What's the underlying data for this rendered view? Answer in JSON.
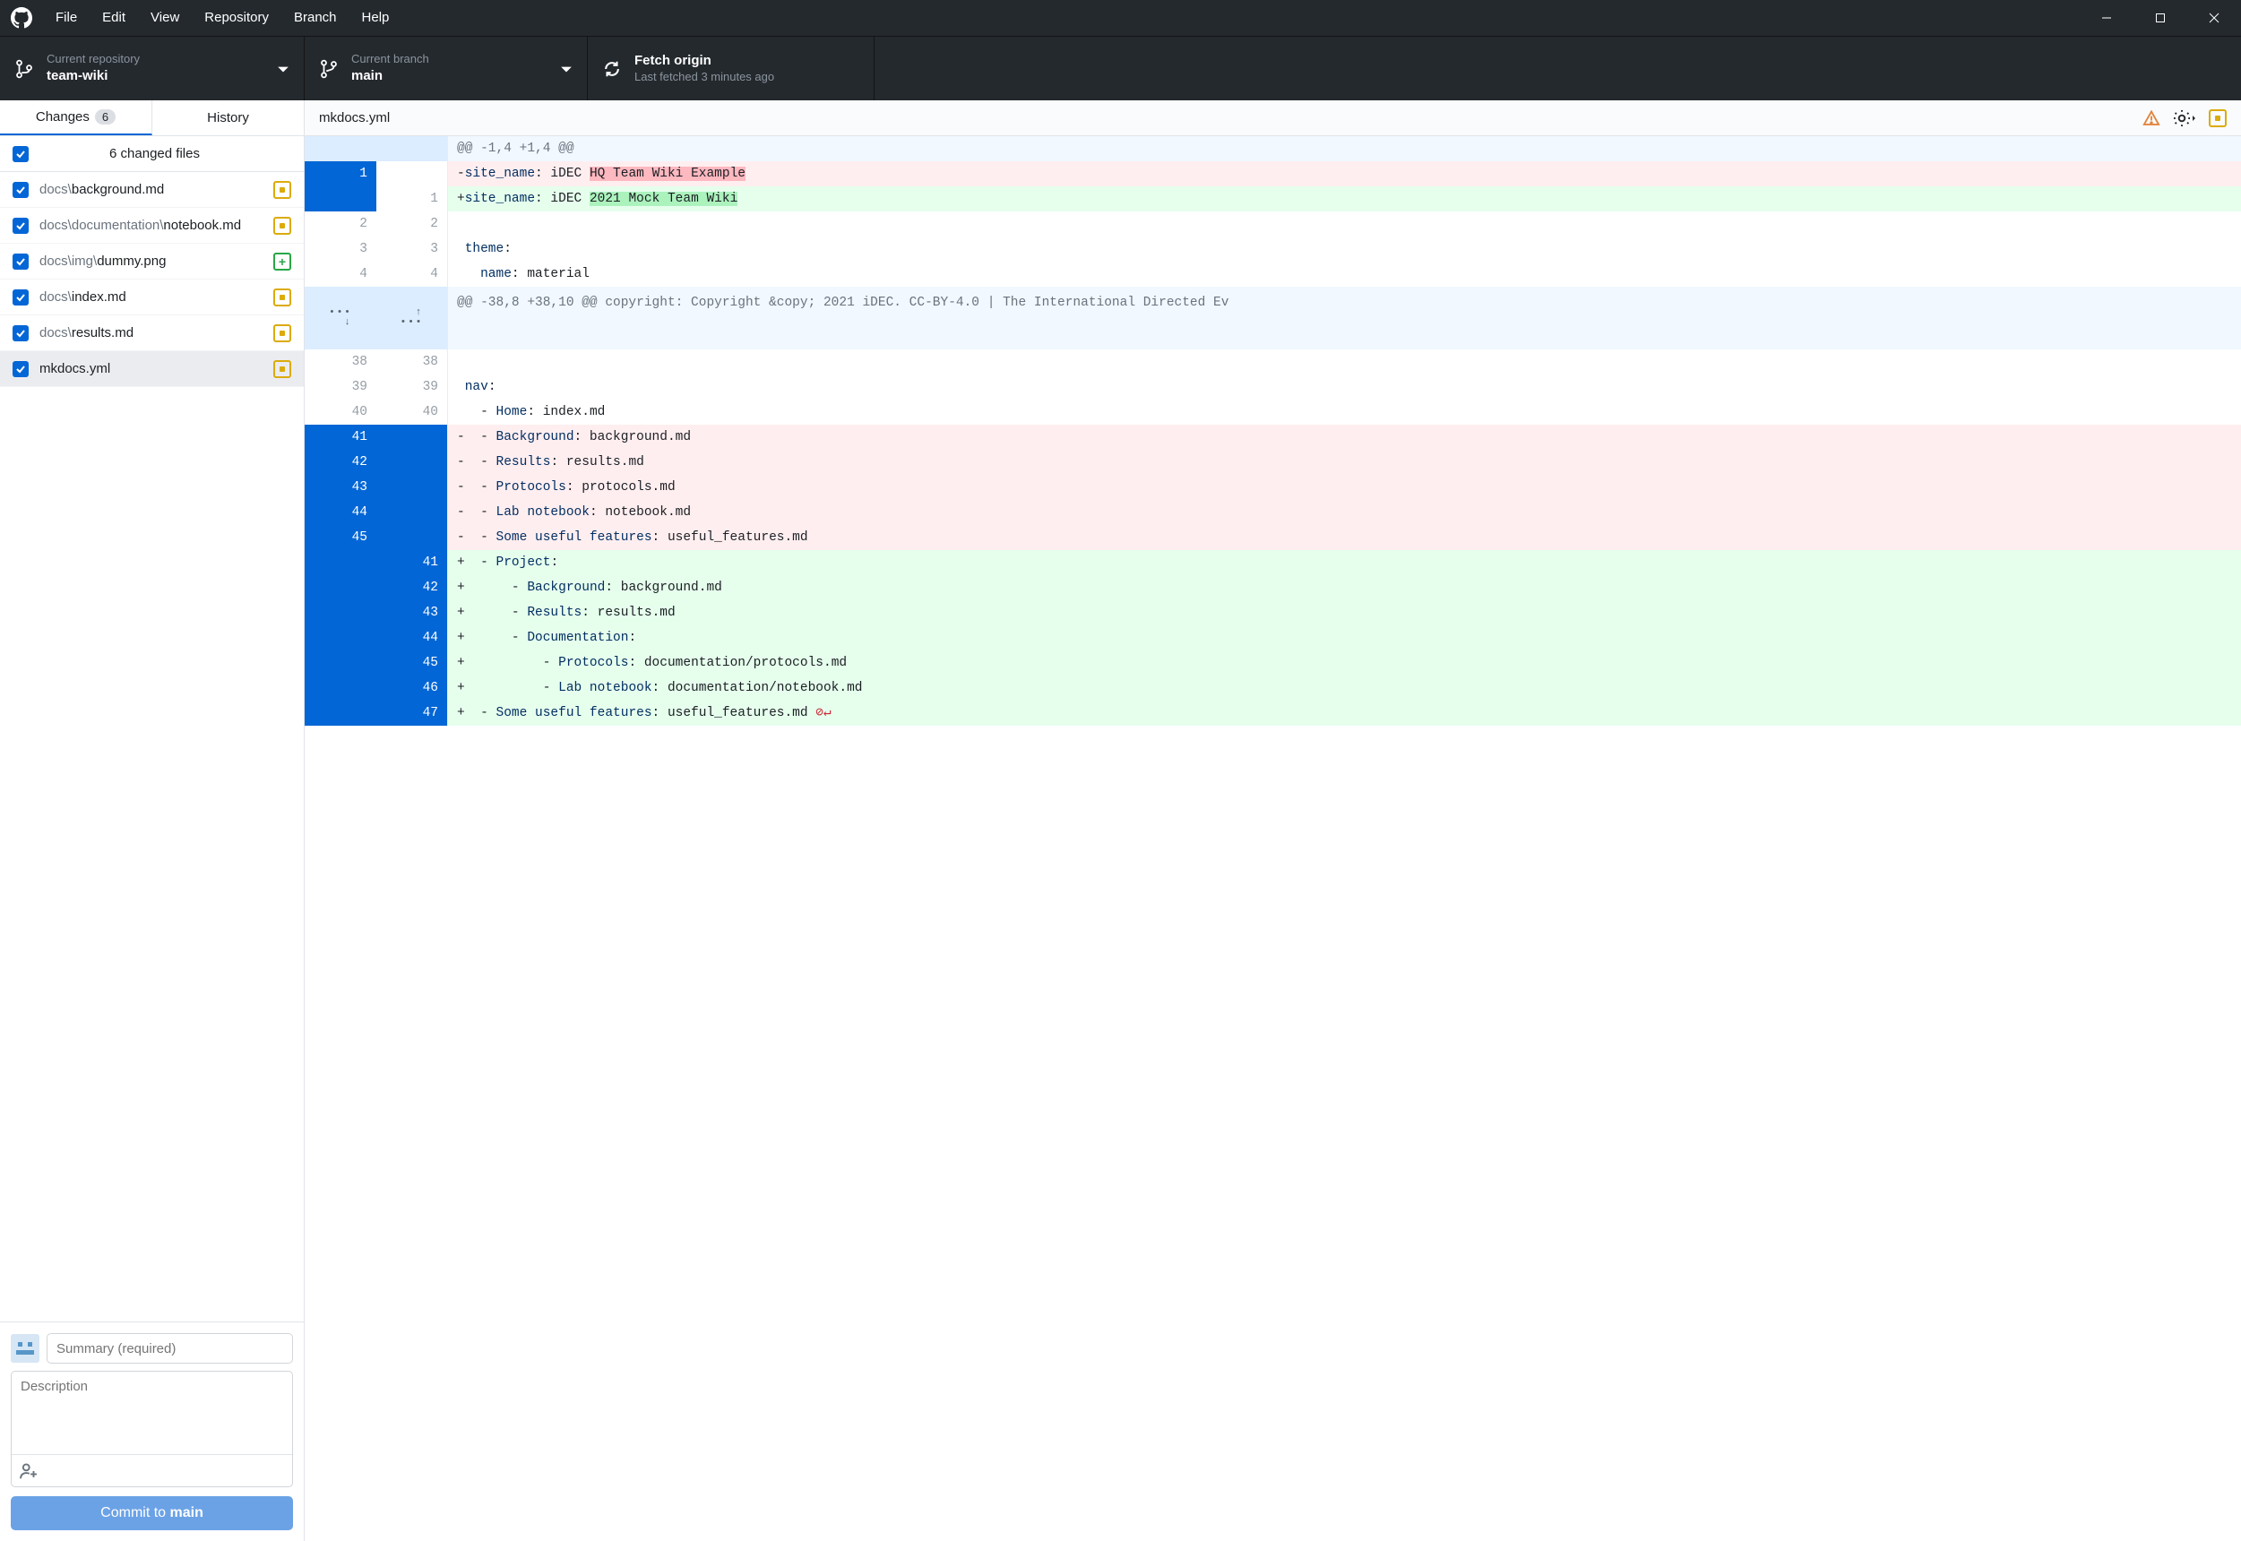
{
  "menu": [
    "File",
    "Edit",
    "View",
    "Repository",
    "Branch",
    "Help"
  ],
  "toolbar": {
    "repo_label": "Current repository",
    "repo_name": "team-wiki",
    "branch_label": "Current branch",
    "branch_name": "main",
    "fetch_label": "Fetch origin",
    "fetch_sub": "Last fetched 3 minutes ago"
  },
  "tabs": {
    "changes": "Changes",
    "changes_count": "6",
    "history": "History"
  },
  "changes_header": "6 changed files",
  "files": [
    {
      "dim": "docs\\",
      "name": "background.md",
      "status": "mod"
    },
    {
      "dim": "docs\\documentation\\",
      "name": "notebook.md",
      "status": "mod"
    },
    {
      "dim": "docs\\img\\",
      "name": "dummy.png",
      "status": "add"
    },
    {
      "dim": "docs\\",
      "name": "index.md",
      "status": "mod"
    },
    {
      "dim": "docs\\",
      "name": "results.md",
      "status": "mod"
    },
    {
      "dim": "",
      "name": "mkdocs.yml",
      "status": "mod",
      "selected": true
    }
  ],
  "commit": {
    "summary_ph": "Summary (required)",
    "desc_ph": "Description",
    "btn_prefix": "Commit to ",
    "btn_branch": "main"
  },
  "diff": {
    "filename": "mkdocs.yml",
    "hunk1": "@@ -1,4 +1,4 @@",
    "line1_del": {
      "pre": "-",
      "k": "site_name",
      "c": ": iDEC ",
      "h": "HQ Team Wiki Example"
    },
    "line1_add": {
      "pre": "+",
      "k": "site_name",
      "c": ": iDEC ",
      "h": "2021 Mock Team Wiki"
    },
    "theme_k": "theme",
    "theme_c": ":",
    "name_k": "name",
    "name_c": ": material",
    "hunk2": "@@ -38,8 +38,10 @@ copyright: Copyright &copy; 2021 iDEC. CC-BY-4.0 | The International Directed Ev",
    "nav_k": "nav",
    "nav_c": ":",
    "home_pre": "  - ",
    "home_k": "Home",
    "home_c": ": index.md",
    "d_bg": {
      "pre": "-  - ",
      "k": "Background",
      "c": ": background.md"
    },
    "d_res": {
      "pre": "-  - ",
      "k": "Results",
      "c": ": results.md"
    },
    "d_prot": {
      "pre": "-  - ",
      "k": "Protocols",
      "c": ": protocols.md"
    },
    "d_lab": {
      "pre": "-  - ",
      "k": "Lab notebook",
      "c": ": notebook.md"
    },
    "d_use": {
      "pre": "-  - ",
      "k": "Some useful features",
      "c": ": useful_features.md"
    },
    "a_proj": {
      "pre": "+  - ",
      "k": "Project",
      "c": ":"
    },
    "a_bg": {
      "pre": "+      - ",
      "k": "Background",
      "c": ": background.md"
    },
    "a_res": {
      "pre": "+      - ",
      "k": "Results",
      "c": ": results.md"
    },
    "a_doc": {
      "pre": "+      - ",
      "k": "Documentation",
      "c": ":"
    },
    "a_prot": {
      "pre": "+          - ",
      "k": "Protocols",
      "c": ": documentation/protocols.md"
    },
    "a_lab": {
      "pre": "+          - ",
      "k": "Lab notebook",
      "c": ": documentation/notebook.md"
    },
    "a_use": {
      "pre": "+  - ",
      "k": "Some useful features",
      "c": ": useful_features.md"
    }
  }
}
